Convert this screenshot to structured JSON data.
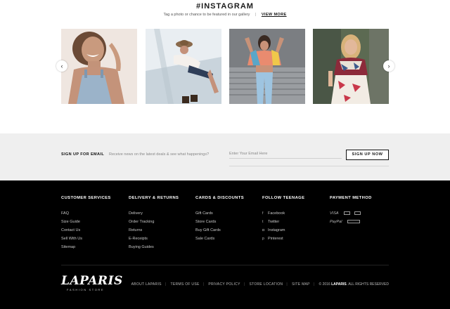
{
  "instagram": {
    "title": "#INSTAGRAM",
    "subtitle": "Tag a photo or chance to be featured in our gallery",
    "separator": "|",
    "view_more": "VIEW MORE",
    "photos": [
      "photo-smiling-woman",
      "photo-woman-lying-sunhat",
      "photo-woman-crop-top",
      "photo-woman-scarf-forest"
    ],
    "arrows": {
      "left": "‹",
      "right": "›"
    }
  },
  "signup": {
    "label": "SIGN UP FOR EMAIL",
    "description": "Receive news on the latest deals & see what happenings?",
    "placeholder": "Enter Your Email Here",
    "button": "SIGN UP NOW"
  },
  "footer": {
    "columns": [
      {
        "title": "CUSTOMER SERVICES",
        "links": [
          "FAQ",
          "Size Guide",
          "Contact Us",
          "Sell With Us",
          "Sitemap"
        ]
      },
      {
        "title": "DELIVERY & RETURNS",
        "links": [
          "Delivery",
          "Order Tracking",
          "Returns",
          "E-Receipts",
          "Buying Guides"
        ]
      },
      {
        "title": "CARDS & DISCOUNTS",
        "links": [
          "Gift Cards",
          "Store Cards",
          "Buy Gift Cards",
          "Sale Cards"
        ]
      },
      {
        "title": "FOLLOW TEENAGE",
        "links": [
          "Facebook",
          "Twitter",
          "Instagram",
          "Pinterest"
        ],
        "icons": [
          "f",
          "t",
          "◘",
          "p"
        ]
      },
      {
        "title": "PAYMENT METHOD",
        "payments": [
          "VISA",
          "PayPal"
        ]
      }
    ],
    "logo": {
      "main": "LAPARIS",
      "sub": "FASHION STORE"
    },
    "bottom_links": [
      "ABOUT LAPARIS",
      "TERMS OF USE",
      "PRIVACY POLICY",
      "STORE LOCATION",
      "SITE MAP"
    ],
    "copyright_prefix": "© 2016",
    "copyright_brand": "LAPARIS",
    "copyright_suffix": ". ALL RIGHTS RESERVED"
  },
  "colors": {
    "footer_bg": "#000000",
    "signup_bg": "#efefef",
    "accent": "#111111"
  }
}
